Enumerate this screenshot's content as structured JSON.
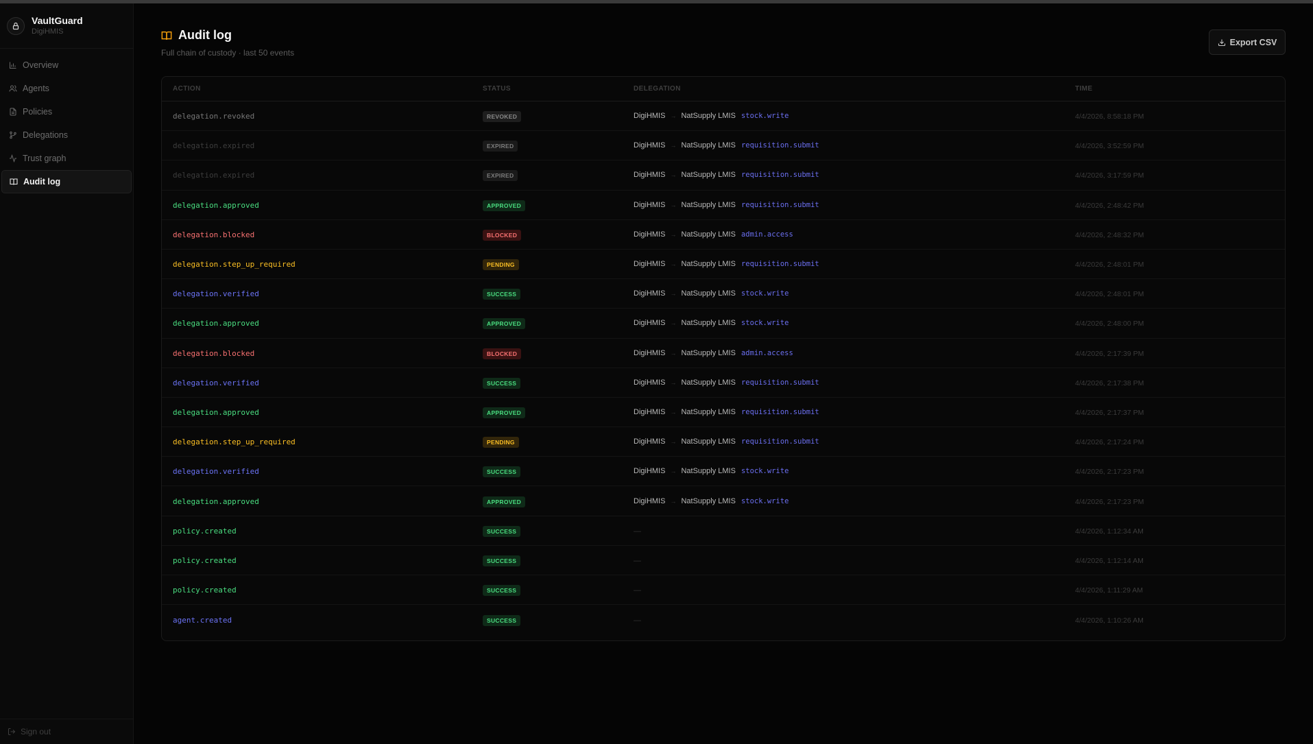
{
  "brand": {
    "name": "VaultGuard",
    "org": "DigiHMIS"
  },
  "nav": [
    {
      "label": "Overview",
      "icon": "bar-chart-icon",
      "active": false
    },
    {
      "label": "Agents",
      "icon": "users-icon",
      "active": false
    },
    {
      "label": "Policies",
      "icon": "file-icon",
      "active": false
    },
    {
      "label": "Delegations",
      "icon": "git-branch-icon",
      "active": false
    },
    {
      "label": "Trust graph",
      "icon": "activity-icon",
      "active": false
    },
    {
      "label": "Audit log",
      "icon": "book-icon",
      "active": true
    }
  ],
  "signout": "Sign out",
  "header": {
    "title": "Audit log",
    "subtitle": "Full chain of custody · last 50 events",
    "export_label": "Export CSV"
  },
  "columns": {
    "action": "ACTION",
    "status": "STATUS",
    "delegation": "DELEGATION",
    "time": "TIME"
  },
  "status_colors": {
    "REVOKED": {
      "fg": "#8a8a8a",
      "bg": "#1e1e1e"
    },
    "EXPIRED": {
      "fg": "#7c7c7c",
      "bg": "#1a1a1a"
    },
    "APPROVED": {
      "fg": "#4ade80",
      "bg": "#0f2a18"
    },
    "BLOCKED": {
      "fg": "#f87171",
      "bg": "#3a1212"
    },
    "PENDING": {
      "fg": "#fbbf24",
      "bg": "#33260a"
    },
    "SUCCESS": {
      "fg": "#4ade80",
      "bg": "#0f2a18"
    }
  },
  "action_colors": {
    "revoked": "#777777",
    "expired": "#3d3d3d",
    "approved": "#4ade80",
    "blocked": "#f87171",
    "pending": "#fbbf24",
    "verified": "#6b73f5",
    "created_green": "#4ade80",
    "created_blue": "#6b73f5"
  },
  "rows": [
    {
      "action": "delegation.revoked",
      "action_color": "revoked",
      "status": "REVOKED",
      "from": "DigiHMIS",
      "to": "NatSupply LMIS",
      "scope": "stock.write",
      "time": "4/4/2026, 8:58:18 PM"
    },
    {
      "action": "delegation.expired",
      "action_color": "expired",
      "status": "EXPIRED",
      "from": "DigiHMIS",
      "to": "NatSupply LMIS",
      "scope": "requisition.submit",
      "time": "4/4/2026, 3:52:59 PM"
    },
    {
      "action": "delegation.expired",
      "action_color": "expired",
      "status": "EXPIRED",
      "from": "DigiHMIS",
      "to": "NatSupply LMIS",
      "scope": "requisition.submit",
      "time": "4/4/2026, 3:17:59 PM"
    },
    {
      "action": "delegation.approved",
      "action_color": "approved",
      "status": "APPROVED",
      "from": "DigiHMIS",
      "to": "NatSupply LMIS",
      "scope": "requisition.submit",
      "time": "4/4/2026, 2:48:42 PM"
    },
    {
      "action": "delegation.blocked",
      "action_color": "blocked",
      "status": "BLOCKED",
      "from": "DigiHMIS",
      "to": "NatSupply LMIS",
      "scope": "admin.access",
      "time": "4/4/2026, 2:48:32 PM"
    },
    {
      "action": "delegation.step_up_required",
      "action_color": "pending",
      "status": "PENDING",
      "from": "DigiHMIS",
      "to": "NatSupply LMIS",
      "scope": "requisition.submit",
      "time": "4/4/2026, 2:48:01 PM"
    },
    {
      "action": "delegation.verified",
      "action_color": "verified",
      "status": "SUCCESS",
      "from": "DigiHMIS",
      "to": "NatSupply LMIS",
      "scope": "stock.write",
      "time": "4/4/2026, 2:48:01 PM"
    },
    {
      "action": "delegation.approved",
      "action_color": "approved",
      "status": "APPROVED",
      "from": "DigiHMIS",
      "to": "NatSupply LMIS",
      "scope": "stock.write",
      "time": "4/4/2026, 2:48:00 PM"
    },
    {
      "action": "delegation.blocked",
      "action_color": "blocked",
      "status": "BLOCKED",
      "from": "DigiHMIS",
      "to": "NatSupply LMIS",
      "scope": "admin.access",
      "time": "4/4/2026, 2:17:39 PM"
    },
    {
      "action": "delegation.verified",
      "action_color": "verified",
      "status": "SUCCESS",
      "from": "DigiHMIS",
      "to": "NatSupply LMIS",
      "scope": "requisition.submit",
      "time": "4/4/2026, 2:17:38 PM"
    },
    {
      "action": "delegation.approved",
      "action_color": "approved",
      "status": "APPROVED",
      "from": "DigiHMIS",
      "to": "NatSupply LMIS",
      "scope": "requisition.submit",
      "time": "4/4/2026, 2:17:37 PM"
    },
    {
      "action": "delegation.step_up_required",
      "action_color": "pending",
      "status": "PENDING",
      "from": "DigiHMIS",
      "to": "NatSupply LMIS",
      "scope": "requisition.submit",
      "time": "4/4/2026, 2:17:24 PM"
    },
    {
      "action": "delegation.verified",
      "action_color": "verified",
      "status": "SUCCESS",
      "from": "DigiHMIS",
      "to": "NatSupply LMIS",
      "scope": "stock.write",
      "time": "4/4/2026, 2:17:23 PM"
    },
    {
      "action": "delegation.approved",
      "action_color": "approved",
      "status": "APPROVED",
      "from": "DigiHMIS",
      "to": "NatSupply LMIS",
      "scope": "stock.write",
      "time": "4/4/2026, 2:17:23 PM"
    },
    {
      "action": "policy.created",
      "action_color": "created_green",
      "status": "SUCCESS",
      "from": "",
      "to": "",
      "scope": "",
      "empty": "—",
      "time": "4/4/2026, 1:12:34 AM"
    },
    {
      "action": "policy.created",
      "action_color": "created_green",
      "status": "SUCCESS",
      "from": "",
      "to": "",
      "scope": "",
      "empty": "—",
      "time": "4/4/2026, 1:12:14 AM"
    },
    {
      "action": "policy.created",
      "action_color": "created_green",
      "status": "SUCCESS",
      "from": "",
      "to": "",
      "scope": "",
      "empty": "—",
      "time": "4/4/2026, 1:11:29 AM"
    },
    {
      "action": "agent.created",
      "action_color": "created_blue",
      "status": "SUCCESS",
      "from": "",
      "to": "",
      "scope": "",
      "empty": "—",
      "time": "4/4/2026, 1:10:26 AM"
    }
  ]
}
